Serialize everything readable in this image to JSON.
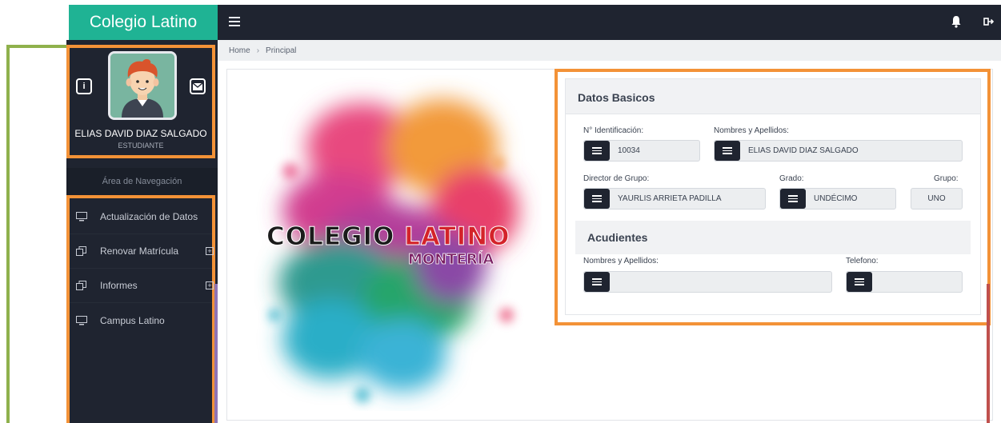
{
  "brand": {
    "title": "Colegio Latino",
    "color": "#1fb394"
  },
  "topbar": {
    "menu_icon": "menu-icon",
    "notifications_icon": "bell-icon",
    "logout_icon": "logout-icon"
  },
  "breadcrumb": {
    "home": "Home",
    "separator": "›",
    "current": "Principal"
  },
  "profile": {
    "name": "ELIAS DAVID DIAZ SALGADO",
    "role": "ESTUDIANTE",
    "info_button": "i",
    "info_icon": "info-icon",
    "mail_icon": "mail-icon"
  },
  "sidebar": {
    "header": "Área de Navegación",
    "items": [
      {
        "label": "Actualización de Datos",
        "icon": "monitor-icon",
        "expandable": false
      },
      {
        "label": "Renovar Matrícula",
        "icon": "copy-icon",
        "expandable": true
      },
      {
        "label": "Informes",
        "icon": "copy-icon",
        "expandable": true
      },
      {
        "label": "Campus Latino",
        "icon": "monitor-icon",
        "expandable": false
      }
    ]
  },
  "logo": {
    "line1_a": "COLEGIO",
    "line1_b": "LATINO",
    "line2": "MONTERÍA"
  },
  "datos_basicos": {
    "title": "Datos Basicos",
    "identificacion": {
      "label": "N° Identificación:",
      "value": "10034"
    },
    "nombres": {
      "label": "Nombres y Apellidos:",
      "value": "ELIAS DAVID DIAZ SALGADO"
    },
    "director": {
      "label": "Director de Grupo:",
      "value": "YAURLIS ARRIETA PADILLA"
    },
    "grado": {
      "label": "Grado:",
      "value": "UNDÉCIMO"
    },
    "grupo": {
      "label": "Grupo:",
      "value": "UNO"
    }
  },
  "acudientes": {
    "title": "Acudientes",
    "nombres": {
      "label": "Nombres y Apellidos:",
      "value": ""
    },
    "telefono": {
      "label": "Telefono:",
      "value": ""
    }
  },
  "colors": {
    "sidebar": "#1f2430",
    "highlight": "#f39237",
    "accent_green": "#8fb14c",
    "accent_red": "#c0504d",
    "accent_purple": "#8e74b3"
  }
}
